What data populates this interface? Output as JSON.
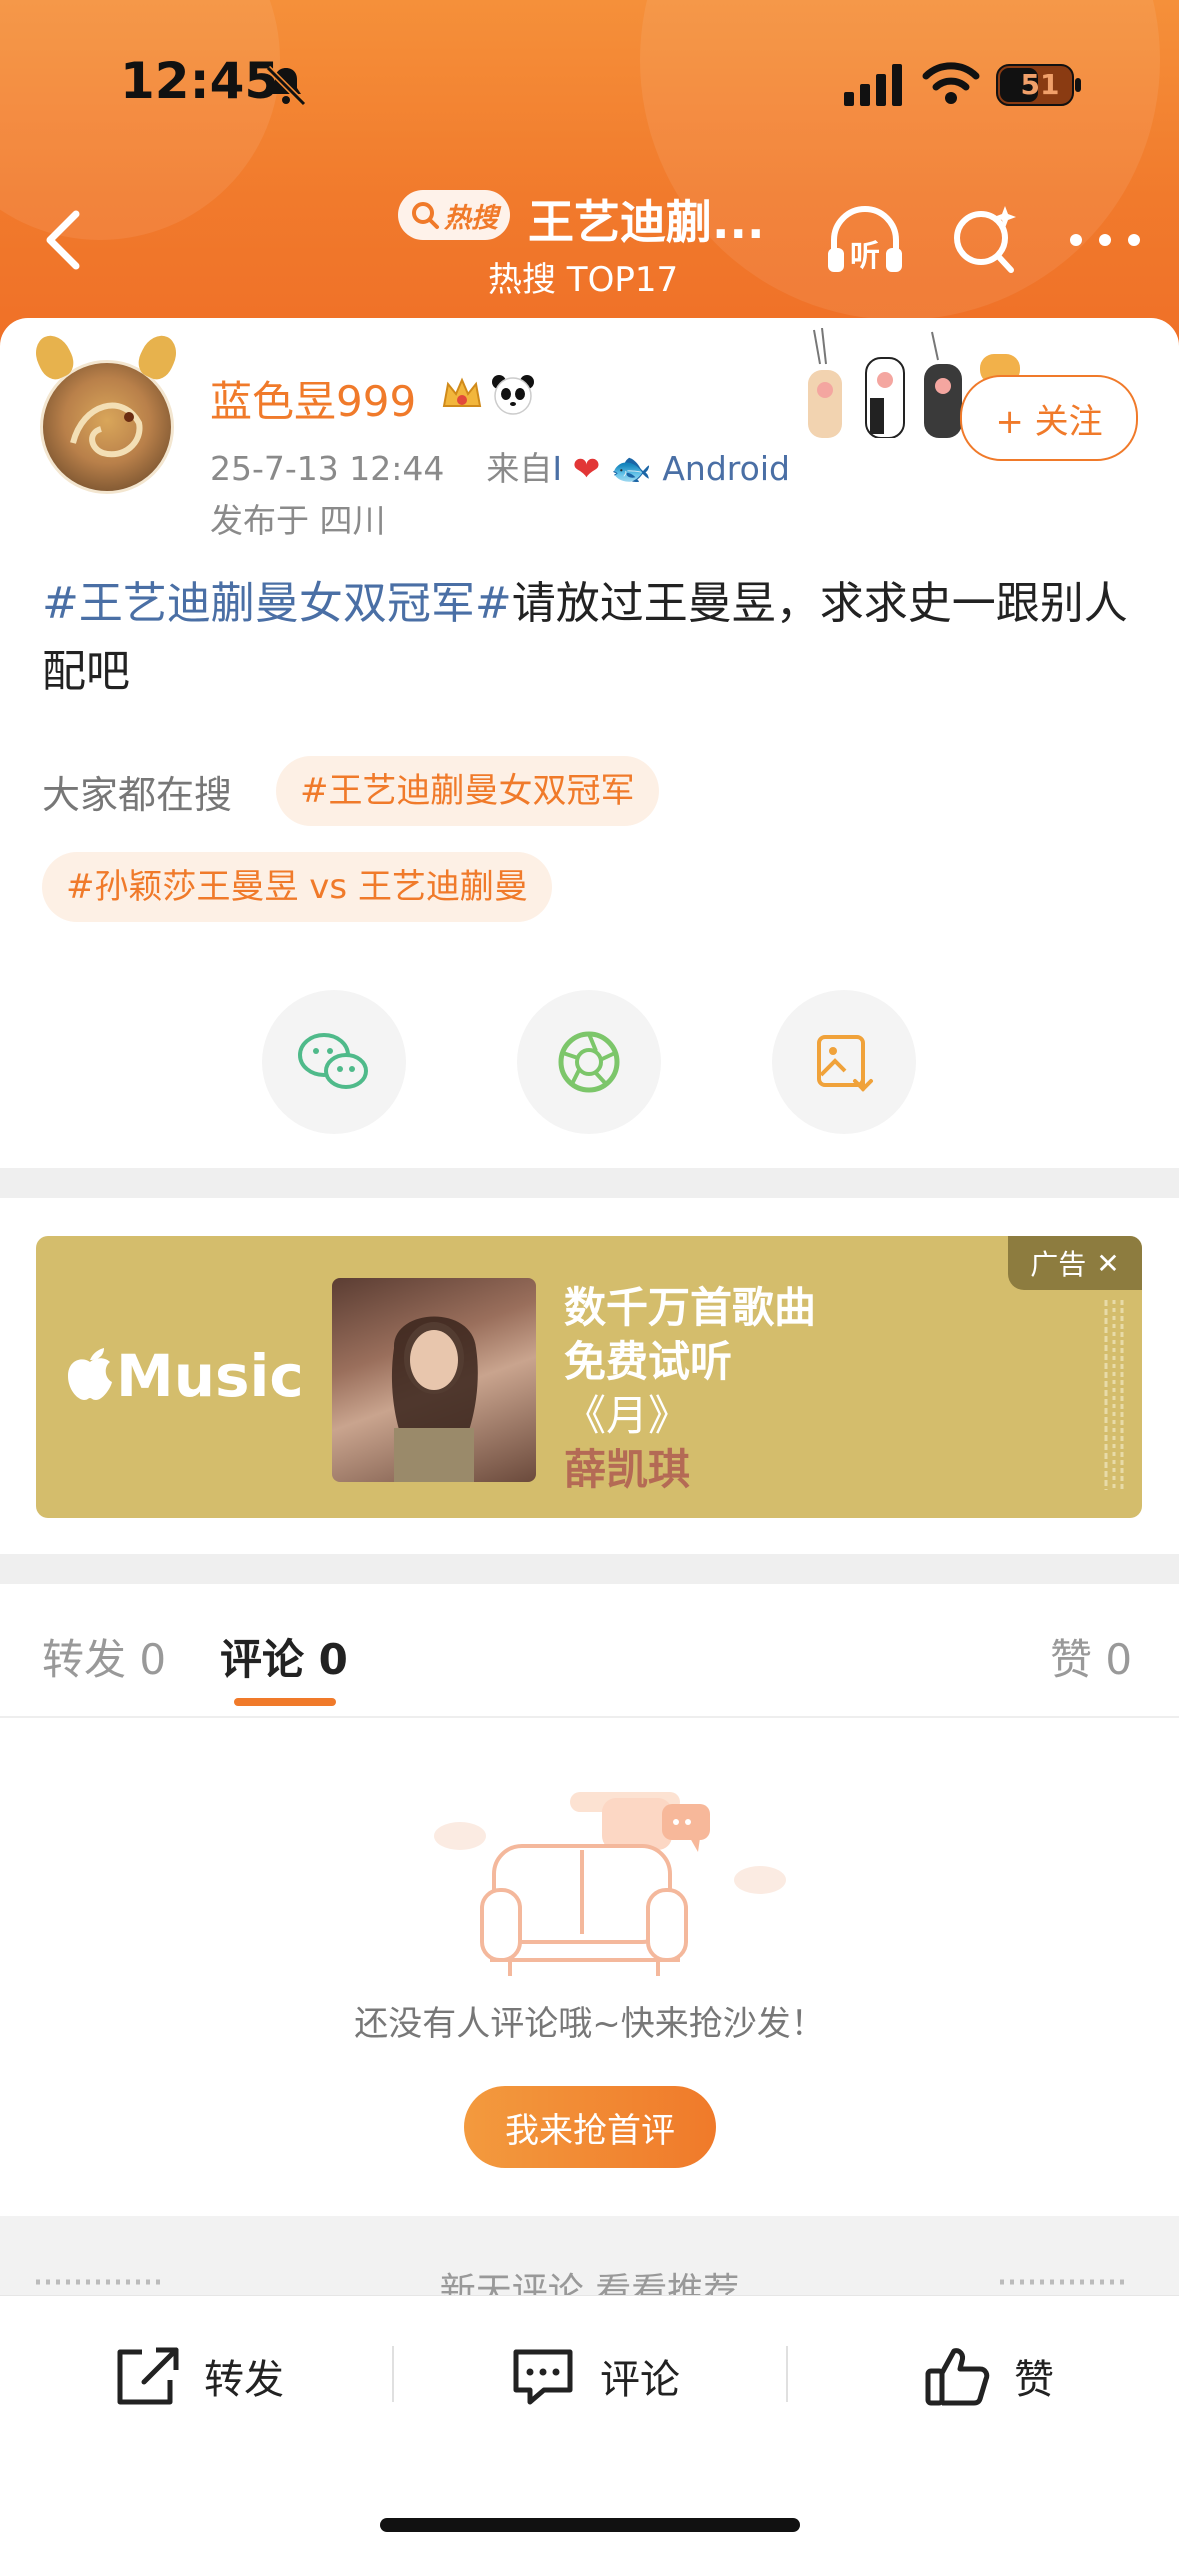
{
  "status_bar": {
    "time": "12:45",
    "battery": "51"
  },
  "header": {
    "hot_badge": "热搜",
    "title": "王艺迪蒯...",
    "subtitle": "热搜 TOP17",
    "listen_label": "听"
  },
  "post": {
    "username": "蓝色昱999",
    "meta_date": "25-7-13 12:44",
    "meta_from": "来自",
    "meta_source": "Android",
    "location": "发布于 四川",
    "follow_label": "+ 关注",
    "hashtag": "#王艺迪蒯曼女双冠军#",
    "body": "请放过王曼昱，求求史一跟别人配吧"
  },
  "trending": {
    "label": "大家都在搜",
    "chips": [
      "#王艺迪蒯曼女双冠军",
      "#孙颖莎王曼昱 vs 王艺迪蒯曼"
    ]
  },
  "ad": {
    "brand": "Music",
    "line1": "数千万首歌曲",
    "line2": "免费试听",
    "song": "《月》",
    "artist": "薛凯琪",
    "badge": "广告"
  },
  "tabs": {
    "repost": "转发 0",
    "comment": "评论 0",
    "like": "赞 0"
  },
  "empty_state": {
    "text": "还没有人评论哦~快来抢沙发！",
    "button": "我来抢首评"
  },
  "more_section": "新天评论 看看推荐",
  "bottom_bar": {
    "repost": "转发",
    "comment": "评论",
    "like": "赞"
  },
  "colors": {
    "accent": "#f07a2a",
    "link": "#4a6fa5",
    "ad_bg": "#d4bd6c"
  }
}
